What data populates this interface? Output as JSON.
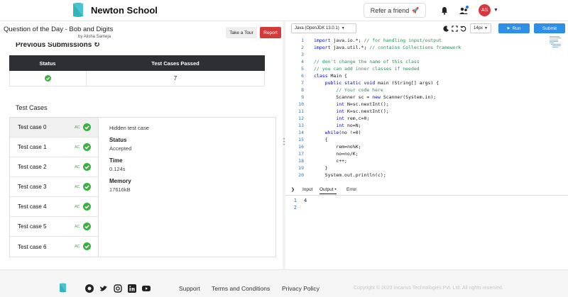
{
  "header": {
    "brand": "Newton School",
    "refer_label": "Refer a friend",
    "avatar_initials": "AS",
    "accent": "#2d8fe6"
  },
  "question": {
    "title": "Question of the Day - Bob and Digits",
    "author": "by Alisha Sameja",
    "tour_label": "Take a Tour",
    "report_label": "Report"
  },
  "submissions": {
    "title": "Previous Submissions",
    "headers": [
      "Status",
      "Test Cases Passed"
    ],
    "rows": [
      {
        "passed": "7"
      }
    ]
  },
  "test_cases": {
    "title": "Test Cases",
    "items": [
      {
        "label": "Test case 0",
        "badge": "AC"
      },
      {
        "label": "Test case 1",
        "badge": "AC"
      },
      {
        "label": "Test case 2",
        "badge": "AC"
      },
      {
        "label": "Test case 3",
        "badge": "AC"
      },
      {
        "label": "Test case 4",
        "badge": "AC"
      },
      {
        "label": "Test case 5",
        "badge": "AC"
      },
      {
        "label": "Test case 6",
        "badge": "AC"
      }
    ],
    "detail": {
      "hidden": "Hidden test case",
      "status_label": "Status",
      "status_value": "Accepted",
      "time_label": "Time",
      "time_value": "0.124s",
      "memory_label": "Memory",
      "memory_value": "17616kB"
    }
  },
  "editor": {
    "language": "Java (OpenJDK 13.0.1)",
    "font_size": "14px",
    "run_label": "Run",
    "submit_label": "Submit",
    "lines": [
      {
        "n": "1",
        "code": "import java.io.*; // for handling input/output"
      },
      {
        "n": "2",
        "code": "import java.util.*; // contains Collections framework"
      },
      {
        "n": "3",
        "code": ""
      },
      {
        "n": "4",
        "code": "// don't change the name of this class"
      },
      {
        "n": "5",
        "code": "// you can add inner classes if needed"
      },
      {
        "n": "6",
        "code": "class Main {"
      },
      {
        "n": "7",
        "code": "    public static void main (String[] args) {"
      },
      {
        "n": "8",
        "code": "        // Your code here"
      },
      {
        "n": "9",
        "code": "        Scanner sc = new Scanner(System.in);"
      },
      {
        "n": "10",
        "code": "        int N=sc.nextInt();"
      },
      {
        "n": "11",
        "code": "        int K=sc.nextInt();"
      },
      {
        "n": "12",
        "code": "        int rem,c=0;"
      },
      {
        "n": "13",
        "code": "        int no=N;"
      },
      {
        "n": "14",
        "code": "    while(no !=0)"
      },
      {
        "n": "15",
        "code": "    {"
      },
      {
        "n": "16",
        "code": "        rem=no%K;"
      },
      {
        "n": "17",
        "code": "        no=no/K;"
      },
      {
        "n": "18",
        "code": "        c++;"
      },
      {
        "n": "19",
        "code": "    }"
      },
      {
        "n": "20",
        "code": "    System.out.println(c);"
      }
    ]
  },
  "output": {
    "tabs": [
      "Input",
      "Output",
      "Error"
    ],
    "lines": [
      {
        "n": "1",
        "text": "4"
      },
      {
        "n": "2",
        "text": ""
      }
    ]
  },
  "footer": {
    "links": [
      "Support",
      "Terms and Conditions",
      "Privacy Policy"
    ],
    "copyright": "Copyright © 2023 Incanus Technologies Pvt. Ltd. All rights reserved.",
    "social_icons": [
      "github-icon",
      "twitter-icon",
      "instagram-icon",
      "linkedin-icon",
      "youtube-icon"
    ]
  }
}
